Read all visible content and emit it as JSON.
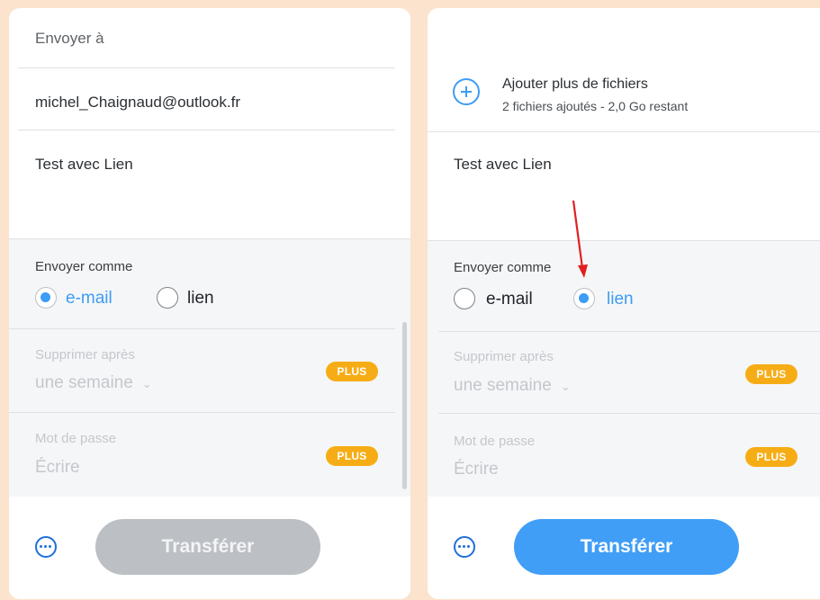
{
  "left_panel": {
    "recipient_label": "Envoyer à",
    "email": "michel_Chaignaud@outlook.fr",
    "message": "Test avec Lien",
    "send_as": {
      "label": "Envoyer comme",
      "options": [
        {
          "label": "e-mail",
          "selected": true
        },
        {
          "label": "lien",
          "selected": false
        }
      ]
    },
    "delete_after": {
      "label": "Supprimer après",
      "value": "une semaine",
      "badge": "PLUS"
    },
    "password": {
      "label": "Mot de passe",
      "placeholder": "Écrire",
      "badge": "PLUS"
    },
    "transfer_label": "Transférer",
    "transfer_enabled": false
  },
  "right_panel": {
    "add_files": {
      "title": "Ajouter plus de fichiers",
      "subtitle": "2 fichiers ajoutés - 2,0 Go restant"
    },
    "message": "Test avec Lien",
    "send_as": {
      "label": "Envoyer comme",
      "options": [
        {
          "label": "e-mail",
          "selected": false
        },
        {
          "label": "lien",
          "selected": true
        }
      ]
    },
    "delete_after": {
      "label": "Supprimer après",
      "value": "une semaine",
      "badge": "PLUS"
    },
    "password": {
      "label": "Mot de passe",
      "placeholder": "Écrire",
      "badge": "PLUS"
    },
    "transfer_label": "Transférer",
    "transfer_enabled": true
  },
  "colors": {
    "accent": "#3d9cf5",
    "badge": "#f6ad15",
    "annotation_arrow": "#e02020",
    "disabled_button": "#bcbfc4"
  },
  "icons": [
    "more-options-icon",
    "add-files-icon",
    "chevron-down-icon",
    "annotation-arrow-icon"
  ]
}
